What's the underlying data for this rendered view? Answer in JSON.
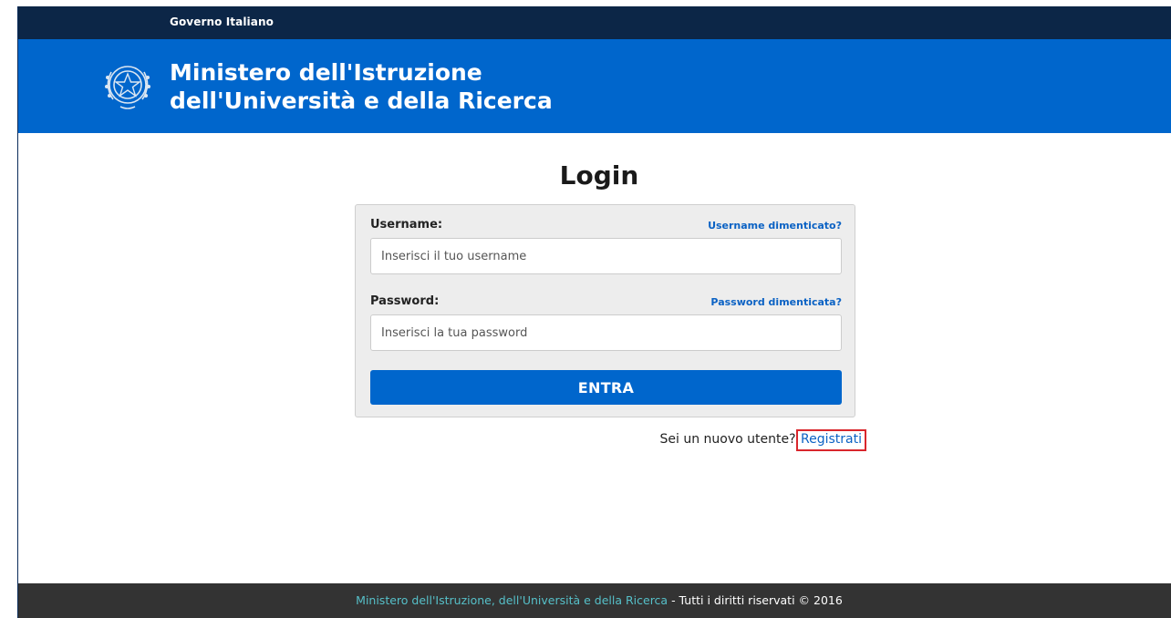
{
  "gov_bar": {
    "label": "Governo Italiano"
  },
  "header": {
    "title_line1": "Ministero dell'Istruzione",
    "title_line2": "dell'Università e della Ricerca",
    "emblem_icon": "italian-republic-emblem-icon"
  },
  "login": {
    "title": "Login",
    "username_label": "Username:",
    "username_forgot": "Username dimenticato?",
    "username_placeholder": "Inserisci il tuo username",
    "password_label": "Password:",
    "password_forgot": "Password dimenticata?",
    "password_placeholder": "Inserisci la tua password",
    "submit_label": "ENTRA"
  },
  "register": {
    "prompt": "Sei un nuovo utente?",
    "link": "Registrati"
  },
  "footer": {
    "link": "Ministero dell'Istruzione, dell'Università e della Ricerca",
    "rights": " - Tutti i diritti riservati © 2016"
  },
  "colors": {
    "gov_bar": "#0c2647",
    "header": "#0066cc",
    "button": "#0066cc",
    "link": "#0b62c4",
    "highlight_border": "#d9262c",
    "footer": "#333333",
    "footer_link": "#56c0c9"
  }
}
